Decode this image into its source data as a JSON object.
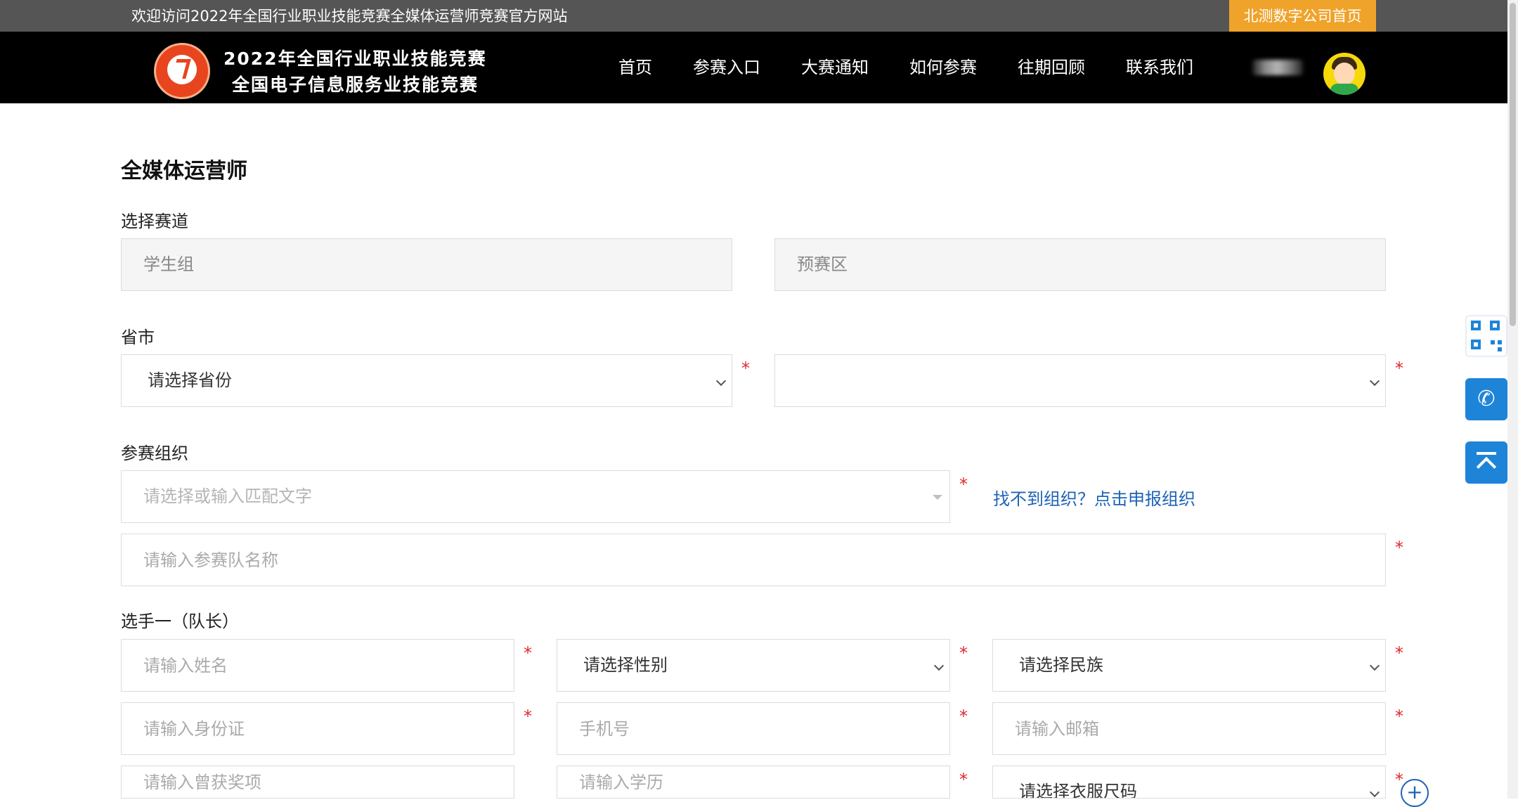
{
  "topbar": {
    "welcome": "欢迎访问2022年全国行业职业技能竞赛全媒体运营师竞赛官方网站",
    "company_link": "北测数字公司首页"
  },
  "header": {
    "logo_line1": "2022年全国行业职业技能竞赛",
    "logo_line2": "全国电子信息服务业技能竞赛",
    "nav": [
      "首页",
      "参赛入口",
      "大赛通知",
      "如何参赛",
      "往期回顾",
      "联系我们"
    ]
  },
  "form": {
    "title": "全媒体运营师",
    "track_label": "选择赛道",
    "track_group": "学生组",
    "track_region": "预赛区",
    "province_label": "省市",
    "province_select": "请选择省份",
    "city_select": "",
    "org_label": "参赛组织",
    "org_placeholder": "请选择或输入匹配文字",
    "org_link": "找不到组织？点击申报组织",
    "team_name_placeholder": "请输入参赛队名称",
    "player_label": "选手一（队长）",
    "name_placeholder": "请输入姓名",
    "gender_select": "请选择性别",
    "ethnicity_select": "请选择民族",
    "id_placeholder": "请输入身份证",
    "phone_placeholder": "手机号",
    "email_placeholder": "请输入邮箱",
    "award_placeholder": "请输入曾获奖项",
    "education_placeholder": "请输入学历",
    "size_select": "请选择衣服尺码",
    "add_symbol": "+",
    "required_mark": "*"
  },
  "side": {
    "phone_glyph": "✆"
  },
  "colors": {
    "topbar_bg": "#555555",
    "header_bg": "#000000",
    "accent_orange": "#f0a32a",
    "link_blue": "#1e62b4",
    "side_blue": "#1e84d8",
    "required_red": "#e0282e"
  }
}
